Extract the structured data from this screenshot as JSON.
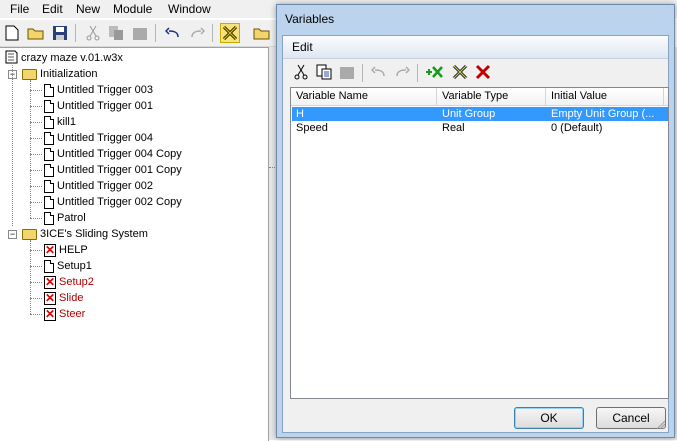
{
  "menubar": [
    "File",
    "Edit",
    "New",
    "Module",
    "Window"
  ],
  "tree": {
    "root": "crazy maze v.01.w3x",
    "categories": [
      {
        "label": "Initialization",
        "items": [
          {
            "label": "Untitled Trigger 003",
            "disabled": false
          },
          {
            "label": "Untitled Trigger 001",
            "disabled": false
          },
          {
            "label": "kill1",
            "disabled": false
          },
          {
            "label": "Untitled Trigger 004",
            "disabled": false
          },
          {
            "label": "Untitled Trigger 004 Copy",
            "disabled": false
          },
          {
            "label": "Untitled Trigger 001 Copy",
            "disabled": false
          },
          {
            "label": "Untitled Trigger 002",
            "disabled": false
          },
          {
            "label": "Untitled Trigger 002 Copy",
            "disabled": false
          },
          {
            "label": "Patrol",
            "disabled": false
          }
        ]
      },
      {
        "label": "3ICE's Sliding System",
        "items": [
          {
            "label": "HELP",
            "disabled": false,
            "x_icon": true
          },
          {
            "label": "Setup1",
            "disabled": false,
            "x_icon": false
          },
          {
            "label": "Setup2",
            "disabled": true,
            "x_icon": true
          },
          {
            "label": "Slide",
            "disabled": true,
            "x_icon": true
          },
          {
            "label": "Steer",
            "disabled": true,
            "x_icon": true
          }
        ]
      }
    ]
  },
  "dialog": {
    "title": "Variables",
    "menu": "Edit",
    "columns": [
      "Variable Name",
      "Variable Type",
      "Initial Value"
    ],
    "rows": [
      {
        "name": "H",
        "type": "Unit Group",
        "value": "Empty Unit Group (...",
        "selected": true
      },
      {
        "name": "Speed",
        "type": "Real",
        "value": "0 (Default)",
        "selected": false
      }
    ],
    "ok_label": "OK",
    "cancel_label": "Cancel"
  },
  "colors": {
    "selection": "#3399ff",
    "disabled_text": "#b00000",
    "dialog_frame": "#bcd3ed"
  }
}
